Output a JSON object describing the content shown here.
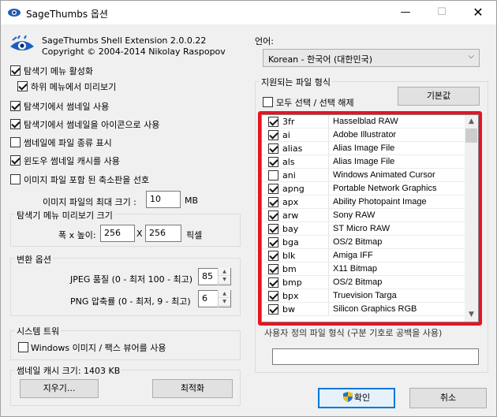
{
  "window": {
    "title": "SageThumbs 옵션",
    "min_glyph": "—",
    "max_glyph": "☐",
    "close_glyph": "✕"
  },
  "header": {
    "product": "SageThumbs Shell Extension 2.0.0.22",
    "copyright": "Copyright © 2004-2014 Nikolay Raspopov"
  },
  "options": [
    {
      "label": "탐색기 메뉴 활성화",
      "checked": true
    },
    {
      "label": "하위 메뉴에서 미리보기",
      "checked": true
    },
    {
      "label": "탐색기에서 썸네일 사용",
      "checked": true
    },
    {
      "label": "탐색기에서 썸네일을 아이콘으로 사용",
      "checked": true
    },
    {
      "label": "썸네일에 파일 종류 표시",
      "checked": false
    },
    {
      "label": "윈도우 썸네일 캐시를 사용",
      "checked": true
    },
    {
      "label": "이미지 파일 포함 된 축소판을 선호",
      "checked": false
    }
  ],
  "max_size": {
    "label": "이미지 파일의 최대 크기 :",
    "value": "10",
    "unit": "MB"
  },
  "preview_group": {
    "title": "탐색기 메뉴 미리보기 크기",
    "label": "폭 x 높이:",
    "width": "256",
    "x": "X",
    "height": "256",
    "unit": "픽셀"
  },
  "convert_group": {
    "title": "변환 옵션",
    "jpeg_label": "JPEG 품질 (0 - 최저 100 - 최고)",
    "jpeg_value": "85",
    "png_label": "PNG 압축률 (0 - 최저, 9 - 최고)",
    "png_value": "6"
  },
  "tray_group": {
    "title": "시스템 트워",
    "label": "Windows 이미지 / 팩스 뷰어를 사용",
    "checked": false
  },
  "cache_group": {
    "title": "썸네일 캐시 크기: 1403 KB",
    "clear": "지우기...",
    "optimize": "최적화"
  },
  "language": {
    "label": "언어:",
    "value": "Korean - 한국어 (대한민국)"
  },
  "formats": {
    "title": "지원되는 파일 형식",
    "select_all": "모두 선택 / 선택 해제",
    "select_all_checked": false,
    "defaults": "기본값",
    "items": [
      {
        "ext": "3fr",
        "desc": "Hasselblad RAW",
        "checked": true
      },
      {
        "ext": "ai",
        "desc": "Adobe Illustrator",
        "checked": true
      },
      {
        "ext": "alias",
        "desc": "Alias Image File",
        "checked": true
      },
      {
        "ext": "als",
        "desc": "Alias Image File",
        "checked": true
      },
      {
        "ext": "ani",
        "desc": "Windows Animated Cursor",
        "checked": false
      },
      {
        "ext": "apng",
        "desc": "Portable Network Graphics",
        "checked": true
      },
      {
        "ext": "apx",
        "desc": "Ability Photopaint Image",
        "checked": true
      },
      {
        "ext": "arw",
        "desc": "Sony RAW",
        "checked": true
      },
      {
        "ext": "bay",
        "desc": "ST Micro RAW",
        "checked": true
      },
      {
        "ext": "bga",
        "desc": "OS/2 Bitmap",
        "checked": true
      },
      {
        "ext": "blk",
        "desc": "Amiga IFF",
        "checked": true
      },
      {
        "ext": "bm",
        "desc": "X11 Bitmap",
        "checked": true
      },
      {
        "ext": "bmp",
        "desc": "OS/2 Bitmap",
        "checked": true
      },
      {
        "ext": "bpx",
        "desc": "Truevision Targa",
        "checked": true
      },
      {
        "ext": "bw",
        "desc": "Silicon Graphics RGB",
        "checked": true
      }
    ]
  },
  "custom": {
    "label": "사용자 정의 파일 형식 (구분 기호로 공백을 사용)",
    "value": ""
  },
  "footer": {
    "ok": "확인",
    "cancel": "취소"
  },
  "colors": {
    "highlight": "#e8141e",
    "default_button": "#0078d7"
  }
}
